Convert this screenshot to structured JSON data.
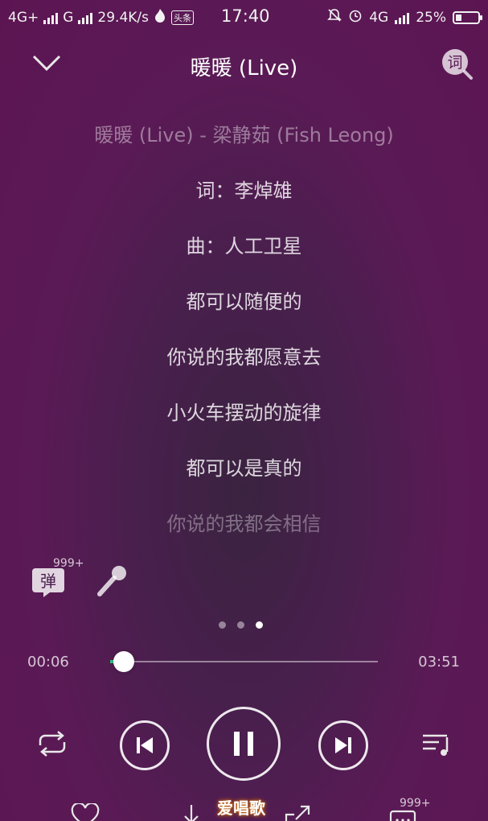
{
  "status": {
    "network1": "4G+",
    "network2": "G",
    "speed": "29.4K/s",
    "news_badge": "头条",
    "time": "17:40",
    "network3": "4G",
    "battery": "25%"
  },
  "header": {
    "title": "暖暖 (Live)",
    "lyric_button": "词"
  },
  "lyrics": {
    "lines": [
      "暖暖 (Live) - 梁静茹 (Fish Leong)",
      "词：李焯雄",
      "曲：人工卫星",
      "都可以随便的",
      "你说的我都愿意去",
      "小火车摆动的旋律",
      "都可以是真的",
      "你说的我都会相信"
    ]
  },
  "tools": {
    "danmu_label": "弹",
    "danmu_count": "999+"
  },
  "pager": {
    "total": 3,
    "active": 3
  },
  "progress": {
    "current": "00:06",
    "total": "03:51",
    "fraction": 0.026
  },
  "bottom": {
    "comment_count": "999+"
  },
  "watermark": "爱唱歌",
  "colors": {
    "accent": "#31c27c"
  }
}
